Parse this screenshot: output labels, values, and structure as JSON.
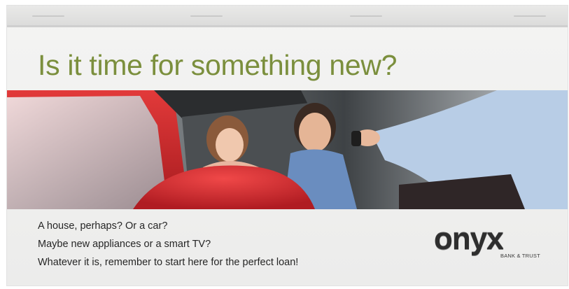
{
  "ad": {
    "headline": "Is it time for something new?",
    "body_lines": [
      "A house, perhaps? Or a car?",
      "Maybe new appliances or a smart TV?",
      "Whatever it is, remember to start here for the perfect loan!"
    ],
    "logo": {
      "wordmark": "onyx",
      "tagline": "BANK & TRUST"
    },
    "photo": "smiling couple in a red car receiving keys",
    "colors": {
      "headline": "#7b8f3d",
      "body_text": "#262626",
      "background": "#efefee"
    }
  }
}
